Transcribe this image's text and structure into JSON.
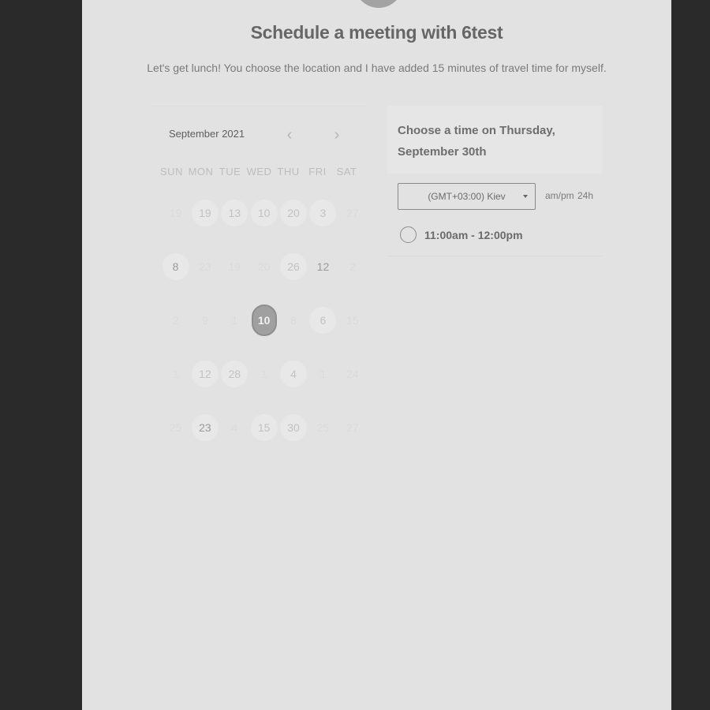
{
  "header": {
    "title": "Schedule a meeting with 6test",
    "description": "Let's get lunch! You choose the location and I have added 15 minutes of travel time for myself."
  },
  "calendar": {
    "month_label": "September 2021",
    "prev_icon": "chevron-left-icon",
    "next_icon": "chevron-right-icon",
    "weekdays": [
      "SUN",
      "MON",
      "TUE",
      "WED",
      "THU",
      "FRI",
      "SAT"
    ],
    "weeks": [
      [
        "19",
        "19",
        "13",
        "10",
        "20",
        "3",
        "27"
      ],
      [
        "8",
        "23",
        "19",
        "20",
        "26",
        "12",
        "2"
      ],
      [
        "2",
        "9",
        "1",
        "10",
        "8",
        "6",
        "15"
      ],
      [
        "1",
        "12",
        "28",
        "1",
        "4",
        "1",
        "24"
      ],
      [
        "25",
        "23",
        "4",
        "15",
        "30",
        "25",
        "27"
      ]
    ],
    "selected_label": "10"
  },
  "time_panel": {
    "heading": "Choose a time on Thursday, September 30th",
    "timezone_value": "(GMT+03:00) Kiev",
    "format_ampm": "am/pm",
    "format_24h": "24h",
    "slots": [
      "11:00am - 12:00pm"
    ]
  },
  "colors": {
    "background": "#2a2a2a",
    "panel": "#e2e2e2",
    "selected_day": "#a0a0a0"
  }
}
